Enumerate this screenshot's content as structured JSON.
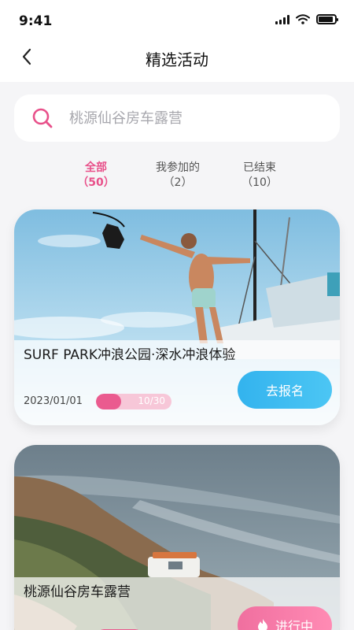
{
  "status_bar": {
    "time": "9:41",
    "icons": [
      "signal-icon",
      "wifi-icon",
      "battery-icon"
    ]
  },
  "header": {
    "title": "精选活动",
    "back_icon": "chevron-left-icon"
  },
  "search": {
    "placeholder": "桃源仙谷房车露营",
    "icon": "search-icon"
  },
  "tabs": [
    {
      "label": "全部",
      "count": "（50）",
      "active": true
    },
    {
      "label": "我参加的",
      "count": "（2）",
      "active": false
    },
    {
      "label": "已结束",
      "count": "（10）",
      "active": false
    }
  ],
  "activities": [
    {
      "title": "SURF PARK冲浪公园·深水冲浪体验",
      "date": "2023/01/01",
      "participants": "10/30",
      "progress": 0.33,
      "button": "去报名",
      "image": "surfer-on-boat-photo"
    },
    {
      "title": "桃源仙谷房车露营",
      "date": "",
      "participants": "",
      "button": "进行中",
      "button_icon": "flame-icon",
      "image": "coastal-campervan-photo"
    }
  ],
  "colors": {
    "accent": "#e8508a",
    "button_blue": "#3ab8ef",
    "button_pink": "#f47aa6"
  }
}
